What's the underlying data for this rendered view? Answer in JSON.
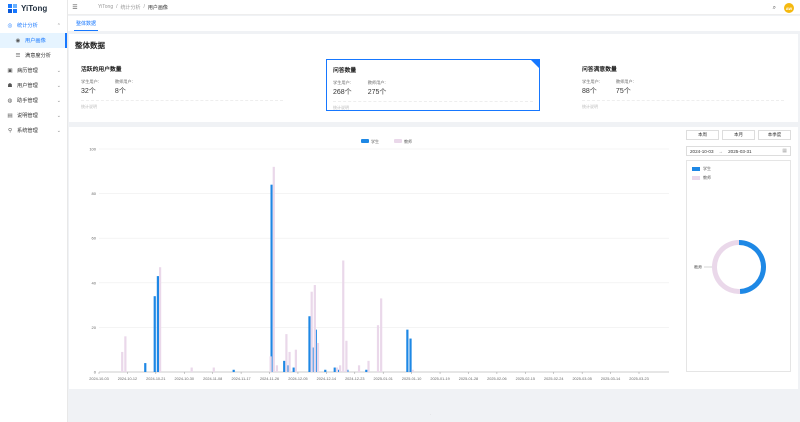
{
  "app": {
    "name": "YiTong"
  },
  "sidebar": {
    "items": [
      {
        "label": "统计分析",
        "icon": "chart-icon",
        "open": true,
        "children": [
          {
            "label": "用户画像",
            "active": true
          },
          {
            "label": "满意度分析",
            "active": false
          }
        ]
      },
      {
        "label": "病历管理",
        "icon": "record-icon"
      },
      {
        "label": "用户管理",
        "icon": "users-icon"
      },
      {
        "label": "助手管理",
        "icon": "assistant-icon"
      },
      {
        "label": "说明管理",
        "icon": "doc-icon"
      },
      {
        "label": "系统管理",
        "icon": "settings-icon"
      }
    ]
  },
  "header": {
    "breadcrumbs": [
      "YiTong",
      "统计分析",
      "用户画像"
    ],
    "avatar_text": "AW"
  },
  "tabs": [
    {
      "label": "整体数据"
    }
  ],
  "overview": {
    "title": "整体数据",
    "cards": [
      {
        "title": "活跃的用户数量",
        "a_label": "学生用户:",
        "a_value": "32个",
        "b_label": "教师用户:",
        "b_value": "8个",
        "foot": "统计说明"
      },
      {
        "title": "问答数量",
        "a_label": "学生用户:",
        "a_value": "268个",
        "b_label": "教师用户:",
        "b_value": "275个",
        "foot": "统计说明"
      },
      {
        "title": "问答满意数量",
        "a_label": "学生用户:",
        "a_value": "88个",
        "b_label": "教师用户:",
        "b_value": "75个",
        "foot": "统计说明"
      }
    ]
  },
  "range_tabs": [
    "本周",
    "本月",
    "本季度"
  ],
  "date_range": {
    "start": "2024-10-03",
    "end": "2025-03-31"
  },
  "colors": {
    "student": "#1e88e5",
    "teacher": "#ead8ea",
    "accent": "#1677ff"
  },
  "chart_data": {
    "type": "bar",
    "legend": [
      "学生",
      "教师"
    ],
    "ylim": [
      0,
      100
    ],
    "yticks": [
      0,
      20,
      40,
      60,
      80,
      100
    ],
    "x_tick_labels": [
      "2024-10-03",
      "2024-10-12",
      "2024-10-21",
      "2024-10-30",
      "2024-11-08",
      "2024-11-17",
      "2024-11-26",
      "2024-12-05",
      "2024-12-14",
      "2024-12-23",
      "2025-01-01",
      "2025-01-10",
      "2025-01-19",
      "2025-01-28",
      "2025-02-06",
      "2025-02-15",
      "2025-02-24",
      "2025-03-05",
      "2025-03-14",
      "2025-03-23"
    ],
    "series": [
      {
        "name": "学生",
        "points": [
          [
            "2024-10-18",
            4
          ],
          [
            "2024-10-21",
            34
          ],
          [
            "2024-10-22",
            43
          ],
          [
            "2024-11-15",
            1
          ],
          [
            "2024-11-27",
            84
          ],
          [
            "2024-12-01",
            5
          ],
          [
            "2024-12-02",
            3
          ],
          [
            "2024-12-04",
            2
          ],
          [
            "2024-12-09",
            25
          ],
          [
            "2024-12-10",
            11
          ],
          [
            "2024-12-11",
            19
          ],
          [
            "2024-12-14",
            1
          ],
          [
            "2024-12-17",
            2
          ],
          [
            "2024-12-18",
            1
          ],
          [
            "2024-12-21",
            1
          ],
          [
            "2024-12-27",
            1
          ],
          [
            "2025-01-09",
            19
          ],
          [
            "2025-01-10",
            15
          ]
        ]
      },
      {
        "name": "教师",
        "points": [
          [
            "2024-10-10",
            9
          ],
          [
            "2024-10-11",
            16
          ],
          [
            "2024-10-22",
            47
          ],
          [
            "2024-11-01",
            2
          ],
          [
            "2024-11-08",
            2
          ],
          [
            "2024-11-26",
            7
          ],
          [
            "2024-11-27",
            92
          ],
          [
            "2024-11-28",
            3
          ],
          [
            "2024-12-01",
            17
          ],
          [
            "2024-12-02",
            9
          ],
          [
            "2024-12-04",
            10
          ],
          [
            "2024-12-09",
            36
          ],
          [
            "2024-12-10",
            39
          ],
          [
            "2024-12-11",
            13
          ],
          [
            "2024-12-17",
            2
          ],
          [
            "2024-12-18",
            3
          ],
          [
            "2024-12-19",
            50
          ],
          [
            "2024-12-20",
            14
          ],
          [
            "2024-12-24",
            3
          ],
          [
            "2024-12-27",
            5
          ],
          [
            "2024-12-30",
            21
          ],
          [
            "2024-12-31",
            33
          ],
          [
            "2025-01-10",
            1
          ]
        ]
      }
    ],
    "pie": {
      "type": "donut",
      "slices": [
        {
          "name": "学生",
          "value": 268
        },
        {
          "name": "教师",
          "value": 275
        }
      ],
      "label": "教师"
    }
  }
}
